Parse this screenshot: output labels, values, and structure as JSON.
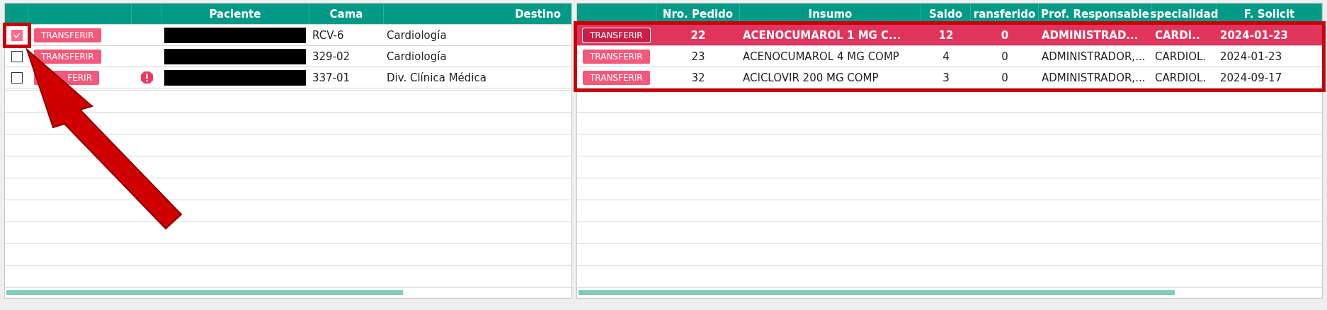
{
  "left_table": {
    "columns": [
      "Paciente",
      "Cama",
      "Destino"
    ],
    "rows": [
      {
        "checked": true,
        "button": "TRANSFERIR",
        "alert": false,
        "patient_redacted": true,
        "cama": "RCV-6",
        "destino": "Cardiología"
      },
      {
        "checked": false,
        "button": "TRANSFERIR",
        "alert": false,
        "patient_redacted": true,
        "cama": "329-02",
        "destino": "Cardiología"
      },
      {
        "checked": false,
        "button": "FERIR",
        "alert": true,
        "patient_redacted": true,
        "cama": "337-01",
        "destino": "Div. Clínica Médica"
      }
    ]
  },
  "right_table": {
    "columns": [
      "Nro. Pedido",
      "Insumo",
      "Saldo",
      "ransferido",
      "Prof. Responsable",
      "specialidad",
      "F. Solicit"
    ],
    "rows": [
      {
        "selected": true,
        "button": "TRANSFERIR",
        "cells": [
          "22",
          "ACENOCUMAROL 1 MG C...",
          "12",
          "0",
          "ADMINISTRAD...",
          "CARDI..",
          "2024-01-23"
        ]
      },
      {
        "selected": false,
        "button": "TRANSFERIR",
        "cells": [
          "23",
          "ACENOCUMAROL 4 MG COMP",
          "4",
          "0",
          "ADMINISTRADOR,...",
          "CARDIOL.",
          "2024-01-23"
        ]
      },
      {
        "selected": false,
        "button": "TRANSFERIR",
        "cells": [
          "32",
          "ACICLOVIR 200 MG COMP",
          "3",
          "0",
          "ADMINISTRADOR,...",
          "CARDIOL.",
          "2024-09-17"
        ]
      }
    ]
  }
}
